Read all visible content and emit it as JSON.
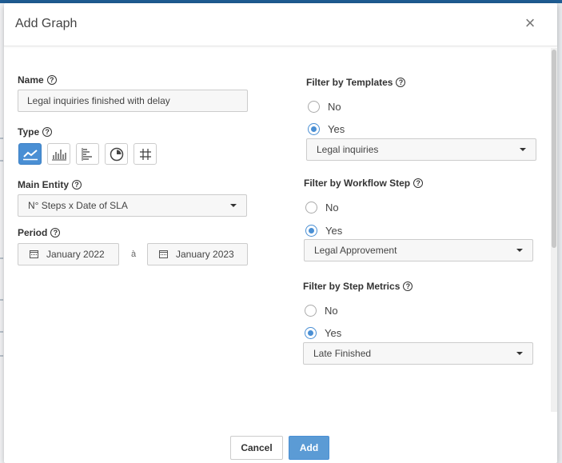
{
  "modal": {
    "title": "Add Graph",
    "close_glyph": "×"
  },
  "form": {
    "name": {
      "label": "Name",
      "value": "Legal inquiries finished with delay"
    },
    "type": {
      "label": "Type",
      "options": [
        {
          "icon": "line-chart-icon",
          "active": true
        },
        {
          "icon": "bar-chart-icon",
          "active": false
        },
        {
          "icon": "horizontal-bar-chart-icon",
          "active": false
        },
        {
          "icon": "pie-chart-icon",
          "active": false
        },
        {
          "icon": "table-grid-icon",
          "active": false
        }
      ]
    },
    "main_entity": {
      "label": "Main Entity",
      "value": "N° Steps x Date of SLA"
    },
    "period": {
      "label": "Period",
      "from": "January 2022",
      "separator": "à",
      "to": "January 2023"
    },
    "filter_templates": {
      "label": "Filter by Templates",
      "no": "No",
      "yes": "Yes",
      "selected": "Yes",
      "value": "Legal inquiries"
    },
    "filter_workflow": {
      "label": "Filter by Workflow Step",
      "no": "No",
      "yes": "Yes",
      "selected": "Yes",
      "value": "Legal Approvement"
    },
    "filter_metrics": {
      "label": "Filter by Step Metrics",
      "no": "No",
      "yes": "Yes",
      "selected": "Yes",
      "value": "Late Finished"
    }
  },
  "footer": {
    "cancel_label": "Cancel",
    "add_label": "Add"
  },
  "colors": {
    "accent": "#4a8fd4",
    "primary_button": "#5b9bd5",
    "top_bar": "#1f5d94"
  }
}
